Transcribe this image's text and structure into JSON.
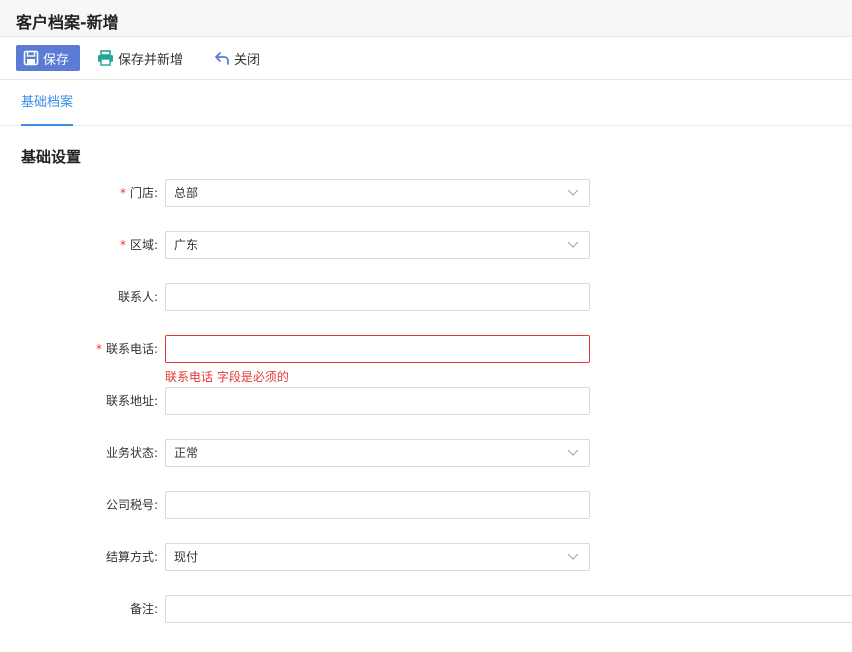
{
  "window": {
    "title": "客户档案-新增"
  },
  "toolbar": {
    "save_label": "保存",
    "save_new_label": "保存并新增",
    "close_label": "关闭"
  },
  "tabs": [
    {
      "label": "基础档案",
      "active": true
    }
  ],
  "section": {
    "title": "基础设置"
  },
  "form": {
    "fields": [
      {
        "label": "门店:",
        "required": true,
        "type": "select",
        "value": "总部"
      },
      {
        "label": "区域:",
        "required": true,
        "type": "select",
        "value": "广东"
      },
      {
        "label": "联系人:",
        "required": false,
        "type": "text",
        "value": ""
      },
      {
        "label": "联系电话:",
        "required": true,
        "type": "text",
        "value": "",
        "error": "联系电话 字段是必须的"
      },
      {
        "label": "联系地址:",
        "required": false,
        "type": "text",
        "value": ""
      },
      {
        "label": "业务状态:",
        "required": false,
        "type": "select",
        "value": "正常"
      },
      {
        "label": "公司税号:",
        "required": false,
        "type": "text",
        "value": ""
      },
      {
        "label": "结算方式:",
        "required": false,
        "type": "select",
        "value": "现付"
      },
      {
        "label": "备注:",
        "required": false,
        "type": "text",
        "value": ""
      }
    ],
    "required_mark": "*"
  },
  "colors": {
    "accent": "#3a8ee6",
    "save_button": "#5b7bd5",
    "error": "#e53935"
  },
  "icons": {
    "save": "floppy-disk-icon",
    "save_new": "printer-icon",
    "close": "undo-arrow-icon",
    "select": "chevron-down-icon"
  }
}
